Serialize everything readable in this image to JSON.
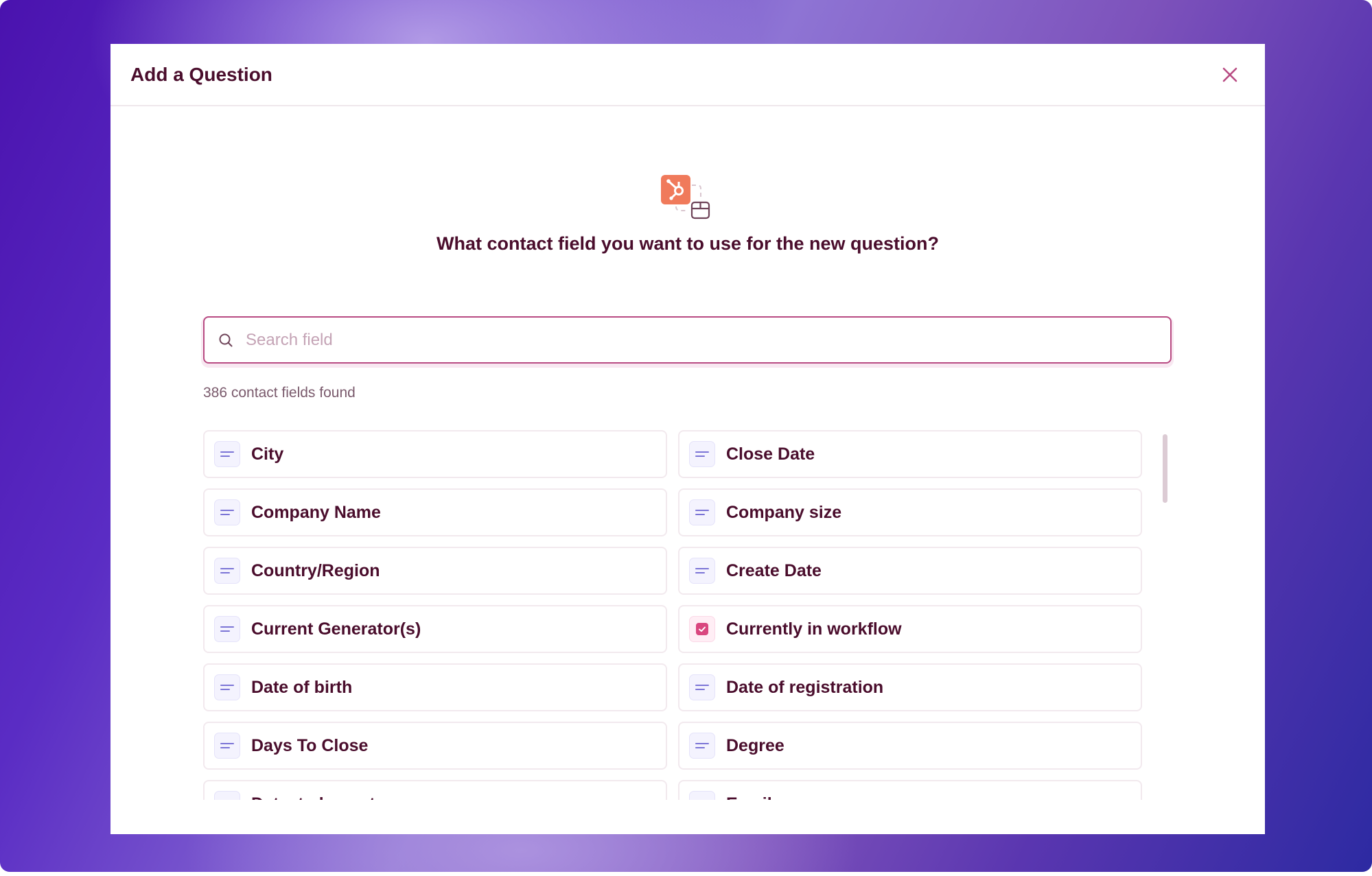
{
  "modal": {
    "title": "Add a Question",
    "close_icon": "close-icon",
    "hero_icons": [
      "hubspot-icon",
      "dashed-connector",
      "form-box-icon"
    ],
    "question": "What contact field you want to use for the new question?"
  },
  "search": {
    "placeholder": "Search field",
    "value": "",
    "icon": "search-icon"
  },
  "results": {
    "count_text": "386 contact fields found",
    "fields": [
      {
        "label": "City",
        "icon": "text-field-icon"
      },
      {
        "label": "Close Date",
        "icon": "text-field-icon"
      },
      {
        "label": "Company Name",
        "icon": "text-field-icon"
      },
      {
        "label": "Company size",
        "icon": "text-field-icon"
      },
      {
        "label": "Country/Region",
        "icon": "text-field-icon"
      },
      {
        "label": "Create Date",
        "icon": "text-field-icon"
      },
      {
        "label": "Current Generator(s)",
        "icon": "text-field-icon"
      },
      {
        "label": "Currently in workflow",
        "icon": "checkbox-icon"
      },
      {
        "label": "Date of birth",
        "icon": "text-field-icon"
      },
      {
        "label": "Date of registration",
        "icon": "text-field-icon"
      },
      {
        "label": "Days To Close",
        "icon": "text-field-icon"
      },
      {
        "label": "Degree",
        "icon": "text-field-icon"
      },
      {
        "label": "Detected country",
        "icon": "text-field-icon"
      },
      {
        "label": "Email",
        "icon": "text-field-icon"
      }
    ]
  },
  "colors": {
    "text_primary": "#4a0d2c",
    "accent": "#b84a82",
    "hubspot_orange": "#f07a5b",
    "field_icon_lines": "#7b74d6",
    "checkbox_fill": "#d9477f"
  }
}
